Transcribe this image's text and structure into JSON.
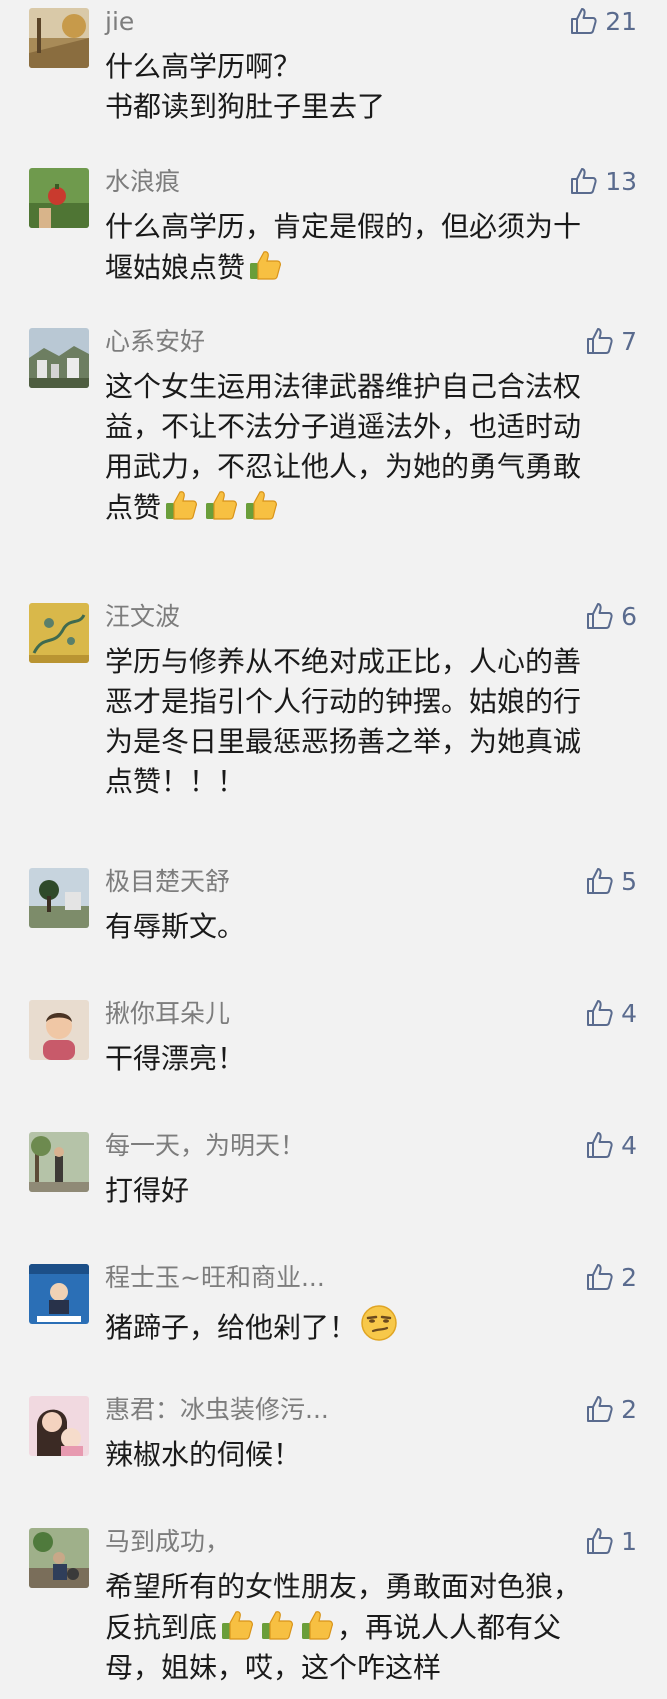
{
  "colors": {
    "background": "#f2f2f2",
    "nickname": "#7d7d7d",
    "like": "#5a6b8e",
    "text": "#1a1a1a"
  },
  "comments": [
    {
      "nickname": "jie",
      "likes": "21",
      "lines": [
        "什么高学历啊？",
        "书都读到狗肚子里去了"
      ]
    },
    {
      "nickname": "水浪痕",
      "likes": "13",
      "lines": [
        "什么高学历，肯定是假的，但必须为十",
        "堰姑娘点赞"
      ],
      "emoji": [
        "thumbs-up"
      ]
    },
    {
      "nickname": "心系安好",
      "likes": "7",
      "lines": [
        "这个女生运用法律武器维护自己合法权",
        "益，不让不法分子逍遥法外，也适时动",
        "用武力，不忍让他人，为她的勇气勇敢",
        "点赞"
      ],
      "emoji": [
        "thumbs-up",
        "thumbs-up",
        "thumbs-up"
      ]
    },
    {
      "nickname": "汪文波",
      "likes": "6",
      "lines": [
        "学历与修养从不绝对成正比，人心的善",
        "恶才是指引个人行动的钟摆。姑娘的行",
        "为是冬日里最惩恶扬善之举，为她真诚",
        "点赞！！！"
      ]
    },
    {
      "nickname": "极目楚天舒",
      "likes": "5",
      "lines": [
        "有辱斯文。"
      ]
    },
    {
      "nickname": "揪你耳朵儿",
      "likes": "4",
      "lines": [
        "干得漂亮！"
      ]
    },
    {
      "nickname": "每一天，为明天！",
      "likes": "4",
      "lines": [
        "打得好"
      ]
    },
    {
      "nickname": "程士玉~旺和商业...",
      "likes": "2",
      "lines": [
        "猪蹄子，给他剁了！"
      ],
      "emoji": [
        "smirk-face"
      ]
    },
    {
      "nickname": "惠君：冰虫装修污...",
      "likes": "2",
      "lines": [
        "辣椒水的伺候！"
      ]
    },
    {
      "nickname": "马到成功，",
      "likes": "1",
      "lines": [
        "希望所有的女性朋友，勇敢面对色狼，",
        "反抗到底",
        "，再说人人都有父",
        "母，姐妹，哎，这个咋这样"
      ],
      "emoji": [
        "thumbs-up",
        "thumbs-up",
        "thumbs-up"
      ]
    }
  ]
}
